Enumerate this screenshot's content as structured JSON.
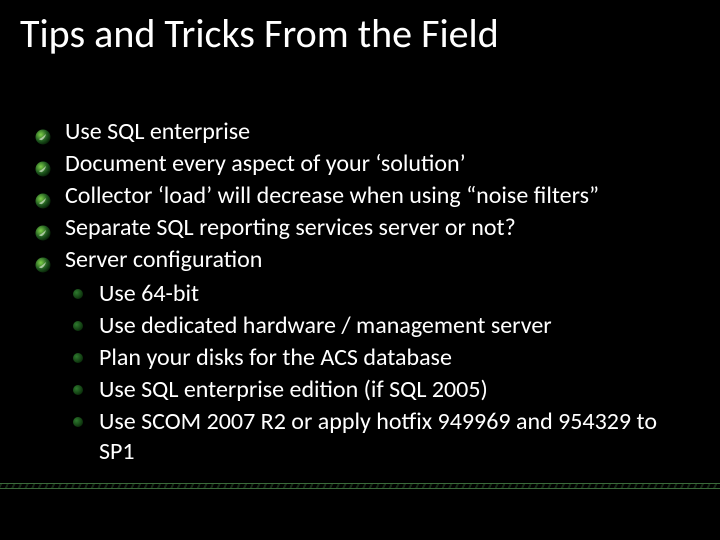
{
  "title": "Tips and Tricks From the Field",
  "bullets": [
    {
      "text": "Use SQL enterprise"
    },
    {
      "text": "Document every aspect of your ‘solution’"
    },
    {
      "text": "Collector ‘load’ will decrease when using “noise filters”"
    },
    {
      "text": "Separate SQL reporting services server or not?"
    },
    {
      "text": "Server configuration",
      "sub": [
        "Use 64-bit",
        "Use dedicated hardware / management server",
        "Plan your disks for the ACS database",
        "Use SQL enterprise edition (if SQL 2005)",
        "Use SCOM 2007 R2 or apply hotfix 949969 and 954329 to SP1"
      ]
    }
  ],
  "colors": {
    "bullet_green_light": "#6fbf3f",
    "bullet_green_dark": "#0d3a0d"
  }
}
